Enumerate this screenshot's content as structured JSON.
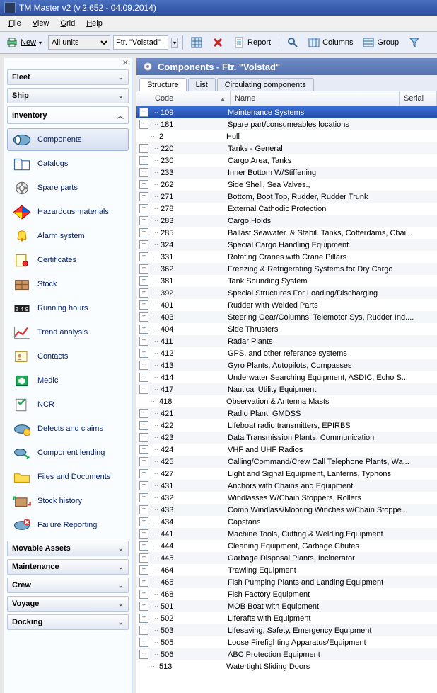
{
  "window": {
    "title": "TM Master v2 (v.2.652 - 04.09.2014)"
  },
  "menu": {
    "file": "File",
    "view": "View",
    "grid": "Grid",
    "help": "Help"
  },
  "toolbar": {
    "new": "New",
    "allunits": "All units",
    "ship": "Ftr. \"Volstad\"",
    "report": "Report",
    "columns": "Columns",
    "group": "Group"
  },
  "left": {
    "sections": {
      "fleet": "Fleet",
      "ship": "Ship",
      "inventory": "Inventory",
      "movable": "Movable Assets",
      "maintenance": "Maintenance",
      "crew": "Crew",
      "voyage": "Voyage",
      "docking": "Docking"
    },
    "inventory_items": [
      {
        "label": "Components",
        "icon": "component",
        "sel": true
      },
      {
        "label": "Catalogs",
        "icon": "catalog"
      },
      {
        "label": "Spare parts",
        "icon": "spare"
      },
      {
        "label": "Hazardous materials",
        "icon": "hazard"
      },
      {
        "label": "Alarm system",
        "icon": "alarm"
      },
      {
        "label": "Certificates",
        "icon": "cert"
      },
      {
        "label": "Stock",
        "icon": "stock"
      },
      {
        "label": "Running hours",
        "icon": "hours"
      },
      {
        "label": "Trend analysis",
        "icon": "trend"
      },
      {
        "label": "Contacts",
        "icon": "contacts"
      },
      {
        "label": "Medic",
        "icon": "medic"
      },
      {
        "label": "NCR",
        "icon": "ncr"
      },
      {
        "label": "Defects and claims",
        "icon": "defect"
      },
      {
        "label": "Component lending",
        "icon": "lending"
      },
      {
        "label": "Files and Documents",
        "icon": "files"
      },
      {
        "label": "Stock history",
        "icon": "stockhist"
      },
      {
        "label": "Failure Reporting",
        "icon": "failure"
      }
    ]
  },
  "panel": {
    "title": "Components - Ftr. \"Volstad\"",
    "tabs": {
      "structure": "Structure",
      "list": "List",
      "circ": "Circulating components"
    },
    "cols": {
      "code": "Code",
      "name": "Name",
      "serial": "Serial"
    }
  },
  "rows": [
    {
      "code": "109",
      "name": "Maintenance Systems",
      "exp": true,
      "sel": true
    },
    {
      "code": "181",
      "name": "Spare part/consumeables locations",
      "exp": true
    },
    {
      "code": "2",
      "name": "Hull",
      "exp": false
    },
    {
      "code": "220",
      "name": "Tanks - General",
      "exp": true
    },
    {
      "code": "230",
      "name": "Cargo Area, Tanks",
      "exp": true
    },
    {
      "code": "233",
      "name": "Inner Bottom W/Stiffening",
      "exp": true
    },
    {
      "code": "262",
      "name": "Side Shell, Sea Valves.,",
      "exp": true
    },
    {
      "code": "271",
      "name": "Bottom, Boot Top, Rudder, Rudder Trunk",
      "exp": true
    },
    {
      "code": "278",
      "name": "External Cathodic Protection",
      "exp": true
    },
    {
      "code": "283",
      "name": "Cargo Holds",
      "exp": true
    },
    {
      "code": "285",
      "name": "Ballast,Seawater. & Stabil. Tanks, Cofferdams, Chai...",
      "exp": true
    },
    {
      "code": "324",
      "name": "Special Cargo Handling Equipment.",
      "exp": true
    },
    {
      "code": "331",
      "name": "Rotating Cranes with Crane Pillars",
      "exp": true
    },
    {
      "code": "362",
      "name": "Freezing & Refrigerating Systems for Dry Cargo",
      "exp": true
    },
    {
      "code": "381",
      "name": "Tank Sounding System",
      "exp": true
    },
    {
      "code": "392",
      "name": "Special Structures For Loading/Discharging",
      "exp": true
    },
    {
      "code": "401",
      "name": "Rudder with Welded Parts",
      "exp": true
    },
    {
      "code": "403",
      "name": "Steering Gear/Columns, Telemotor Sys, Rudder Ind....",
      "exp": true
    },
    {
      "code": "404",
      "name": "Side Thrusters",
      "exp": true
    },
    {
      "code": "411",
      "name": "Radar Plants",
      "exp": true
    },
    {
      "code": "412",
      "name": "GPS, and other referance systems",
      "exp": true
    },
    {
      "code": "413",
      "name": "Gyro Plants, Autopilots, Compasses",
      "exp": true
    },
    {
      "code": "414",
      "name": "Underwater Searching Equipment, ASDIC, Echo S...",
      "exp": true
    },
    {
      "code": "417",
      "name": "Nautical Utility Equipment",
      "exp": true
    },
    {
      "code": "418",
      "name": "Observation & Antenna Masts",
      "exp": false
    },
    {
      "code": "421",
      "name": "Radio Plant, GMDSS",
      "exp": true
    },
    {
      "code": "422",
      "name": "Lifeboat radio transmitters, EPIRBS",
      "exp": true
    },
    {
      "code": "423",
      "name": "Data Transmission Plants, Communication",
      "exp": true
    },
    {
      "code": "424",
      "name": "VHF and UHF Radios",
      "exp": true
    },
    {
      "code": "425",
      "name": "Calling/Command/Crew Call Telephone Plants, Wa...",
      "exp": true
    },
    {
      "code": "427",
      "name": "Light and Signal Equipment, Lanterns, Typhons",
      "exp": true
    },
    {
      "code": "431",
      "name": "Anchors with Chains and Equipment",
      "exp": true
    },
    {
      "code": "432",
      "name": "Windlasses W/Chain Stoppers, Rollers",
      "exp": true
    },
    {
      "code": "433",
      "name": "Comb.Windlass/Mooring Winches w/Chain Stoppe...",
      "exp": true
    },
    {
      "code": "434",
      "name": "Capstans",
      "exp": true
    },
    {
      "code": "441",
      "name": "Machine Tools, Cutting & Welding Equipment",
      "exp": true
    },
    {
      "code": "444",
      "name": "Cleaning Equipment, Garbage Chutes",
      "exp": true
    },
    {
      "code": "445",
      "name": "Garbage Disposal Plants, Incinerator",
      "exp": true
    },
    {
      "code": "464",
      "name": "Trawling Equipment",
      "exp": true
    },
    {
      "code": "465",
      "name": "Fish Pumping Plants and Landing Equipment",
      "exp": true
    },
    {
      "code": "468",
      "name": "Fish Factory Equipment",
      "exp": true
    },
    {
      "code": "501",
      "name": "MOB Boat with Equipment",
      "exp": true
    },
    {
      "code": "502",
      "name": "Liferafts with Equipment",
      "exp": true
    },
    {
      "code": "503",
      "name": "Lifesaving, Safety, Emergency Equipment",
      "exp": true
    },
    {
      "code": "505",
      "name": "Loose Firefighting Apparatus/Equipment",
      "exp": true
    },
    {
      "code": "506",
      "name": "ABC Protection Equipment",
      "exp": true
    },
    {
      "code": "513",
      "name": "Watertight Sliding Doors",
      "exp": false
    }
  ]
}
